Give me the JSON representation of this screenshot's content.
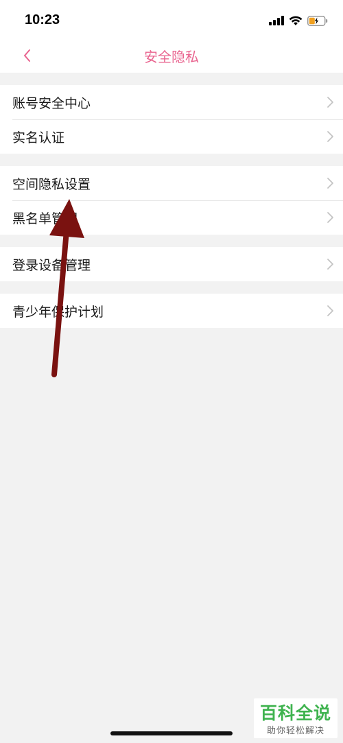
{
  "status_bar": {
    "time": "10:23",
    "icons": [
      "signal-icon",
      "wifi-icon",
      "battery-charging-icon"
    ],
    "battery_color": "#f0a020"
  },
  "nav": {
    "title": "安全隐私",
    "back_icon": "chevron-left-icon",
    "accent_color": "#e9648f"
  },
  "groups": [
    {
      "items": [
        {
          "label": "账号安全中心"
        },
        {
          "label": "实名认证"
        }
      ]
    },
    {
      "items": [
        {
          "label": "空间隐私设置"
        },
        {
          "label": "黑名单管理"
        }
      ]
    },
    {
      "items": [
        {
          "label": "登录设备管理"
        }
      ]
    },
    {
      "items": [
        {
          "label": "青少年保护计划"
        }
      ]
    }
  ],
  "annotation": {
    "icon": "arrow-up-icon",
    "color": "#7a1210"
  },
  "watermark": {
    "title": "百科全说",
    "subtitle": "助你轻松解决",
    "color": "#3fb34f"
  }
}
